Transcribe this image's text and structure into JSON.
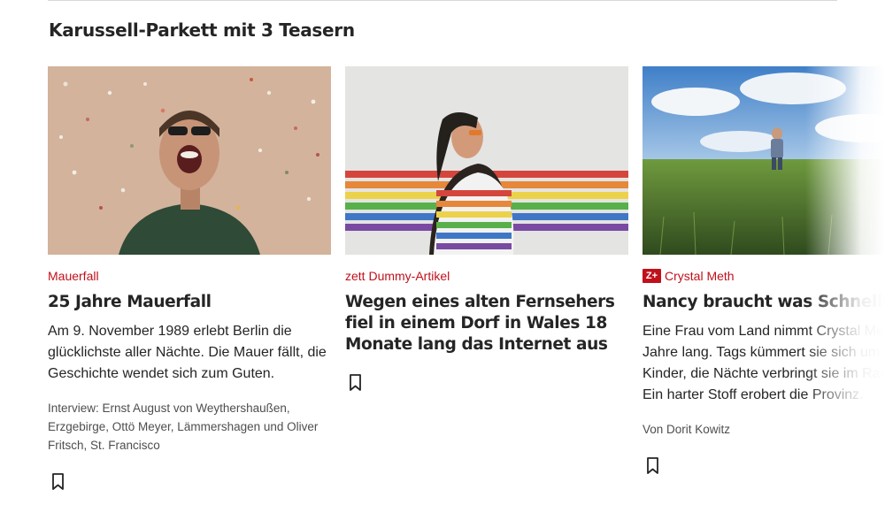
{
  "section": {
    "title": "Karussell-Parkett mit 3 Teasern"
  },
  "teasers": [
    {
      "kicker": "Mauerfall",
      "zplus": false,
      "headline": "25 Jahre Mauerfall",
      "summary": "Am 9. November 1989 erlebt Berlin die glücklichste aller Nächte. Die Mauer fällt, die Geschichte wendet sich zum Guten.",
      "byline": "Interview: Ernst August von Weythershaußen, Erzgebirge, Ottö Meyer, Lämmershagen und Oliver Fritsch, St. Francisco",
      "icon": "bookmark-icon"
    },
    {
      "kicker": "zett Dummy-Artikel",
      "zplus": false,
      "headline": "Wegen eines alten Fernsehers fiel in einem Dorf in Wales 18 Monate lang das Internet aus",
      "summary": "",
      "byline": "",
      "icon": "bookmark-icon"
    },
    {
      "kicker": "Crystal Meth",
      "zplus": true,
      "zplus_label": "Z+",
      "headline": "Nancy braucht was Schnelles",
      "summary": "Eine Frau vom Land nimmt Crystal Meth, Jahre lang. Tags kümmert sie sich um die Kinder, die Nächte verbringt sie im Rausch. Ein harter Stoff erobert die Provinz.",
      "byline": "Von Dorit Kowitz",
      "icon": "bookmark-icon"
    }
  ],
  "colors": {
    "kicker": "#c0101b",
    "text": "#252525",
    "byline": "#4e4e4e"
  }
}
